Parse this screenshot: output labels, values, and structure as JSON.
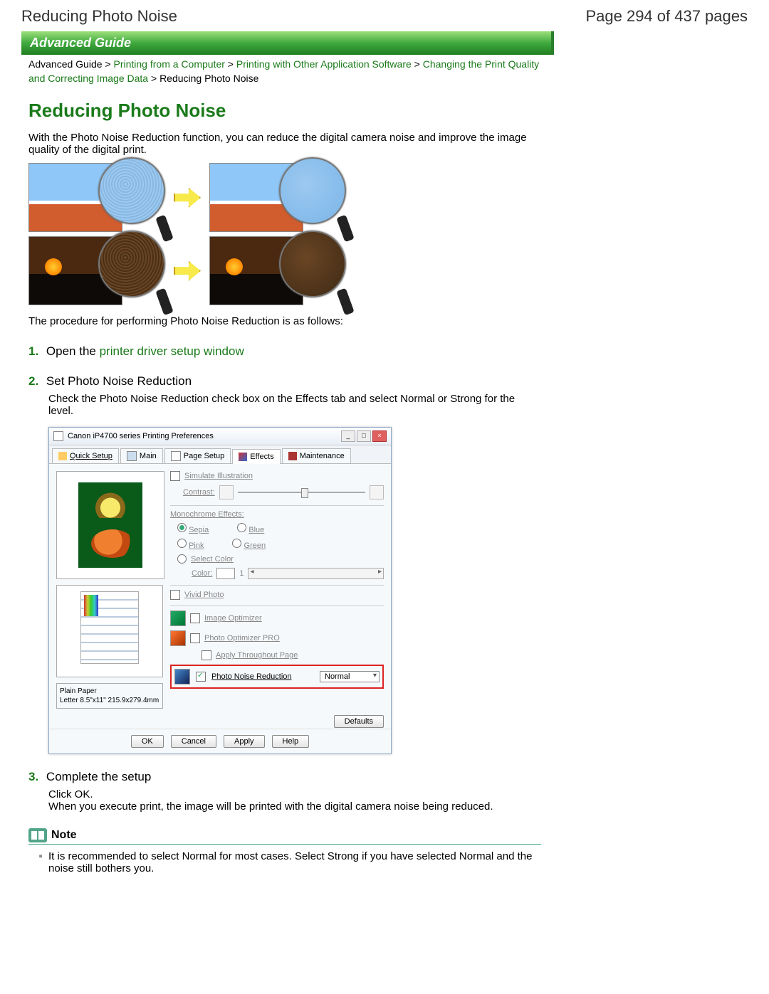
{
  "header": {
    "title": "Reducing Photo Noise",
    "page_indicator": "Page 294 of 437 pages"
  },
  "banner": "Advanced Guide",
  "breadcrumb": {
    "items": [
      "Advanced Guide",
      "Printing from a Computer",
      "Printing with Other Application Software",
      "Changing the Print Quality and Correcting Image Data"
    ],
    "current": "Reducing Photo Noise",
    "sep": ">"
  },
  "title": "Reducing Photo Noise",
  "intro": "With the Photo Noise Reduction function, you can reduce the digital camera noise and improve the image quality of the digital print.",
  "procedure_line": "The procedure for performing Photo Noise Reduction is as follows:",
  "steps": {
    "s1": {
      "num": "1.",
      "prefix": "Open the ",
      "link": "printer driver setup window"
    },
    "s2": {
      "num": "2.",
      "head": "Set Photo Noise Reduction",
      "body": "Check the Photo Noise Reduction check box on the Effects tab and select Normal or Strong for the level."
    },
    "s3": {
      "num": "3.",
      "head": "Complete the setup",
      "body1": "Click OK.",
      "body2": "When you execute print, the image will be printed with the digital camera noise being reduced."
    }
  },
  "dialog": {
    "title": "Canon iP4700 series Printing Preferences",
    "tabs": {
      "quick": "Quick Setup",
      "main": "Main",
      "page": "Page Setup",
      "effects": "Effects",
      "maint": "Maintenance"
    },
    "right": {
      "simulate": "Simulate Illustration",
      "contrast": "Contrast:",
      "mono_head": "Monochrome Effects:",
      "sepia": "Sepia",
      "blue": "Blue",
      "pink": "Pink",
      "green": "Green",
      "select_color": "Select Color",
      "color_label": "Color:",
      "color_val": "1",
      "vivid": "Vivid Photo",
      "img_opt": "Image Optimizer",
      "pop": "Photo Optimizer PRO",
      "apply_page": "Apply Throughout Page",
      "pnr": "Photo Noise Reduction",
      "pnr_level": "Normal",
      "defaults": "Defaults"
    },
    "paper": {
      "line1": "Plain Paper",
      "line2": "Letter 8.5\"x11\" 215.9x279.4mm"
    },
    "buttons": {
      "ok": "OK",
      "cancel": "Cancel",
      "apply": "Apply",
      "help": "Help"
    }
  },
  "note": {
    "title": "Note",
    "item1": "It is recommended to select Normal for most cases. Select Strong if you have selected Normal and the noise still bothers you."
  }
}
